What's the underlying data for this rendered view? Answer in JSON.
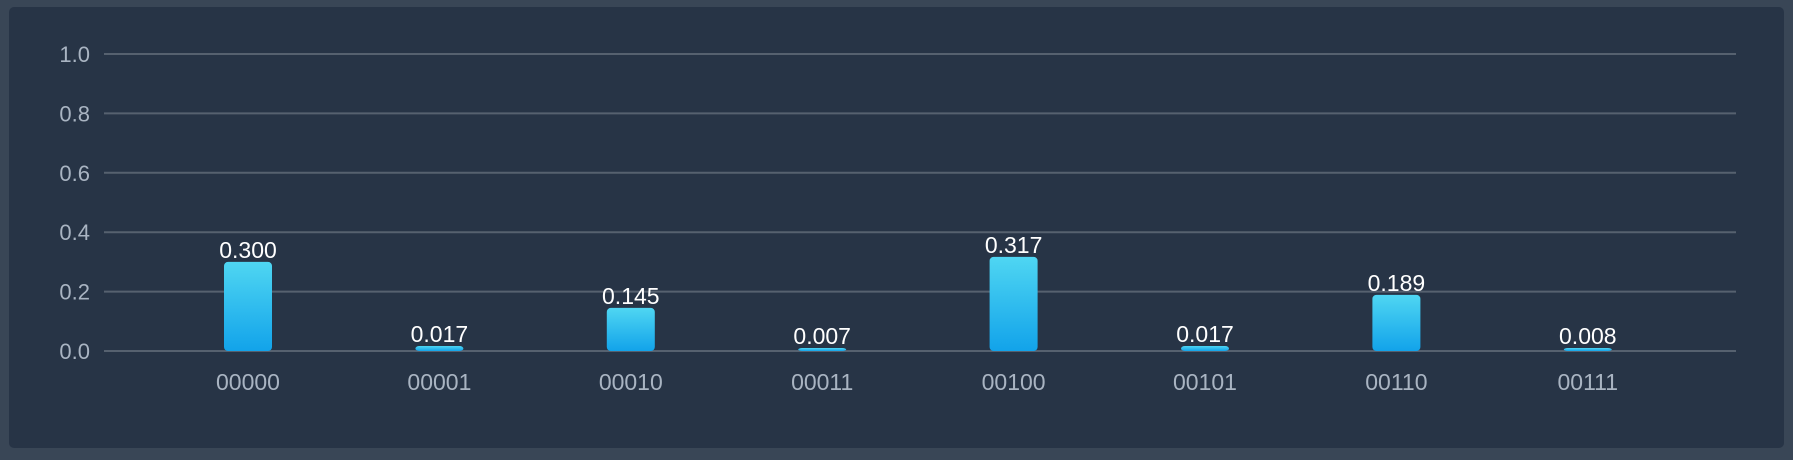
{
  "colors": {
    "page_background": "#394656",
    "panel_background": "#273446",
    "bar_top": "#4fd6f2",
    "bar_bottom": "#12a3ea",
    "gridline": "#56616f",
    "tick_label": "#a9b4c2",
    "value_label": "#ffffff"
  },
  "chart_data": {
    "type": "bar",
    "title": "",
    "xlabel": "",
    "ylabel": "",
    "categories": [
      "00000",
      "00001",
      "00010",
      "00011",
      "00100",
      "00101",
      "00110",
      "00111"
    ],
    "values": [
      0.3,
      0.017,
      0.145,
      0.007,
      0.317,
      0.017,
      0.189,
      0.008
    ],
    "value_labels": [
      "0.300",
      "0.017",
      "0.145",
      "0.007",
      "0.317",
      "0.017",
      "0.189",
      "0.008"
    ],
    "ylim": [
      0,
      1.0
    ],
    "yticks": [
      "0.0",
      "0.2",
      "0.4",
      "0.6",
      "0.8",
      "1.0"
    ],
    "grid": true,
    "legend": "none"
  }
}
